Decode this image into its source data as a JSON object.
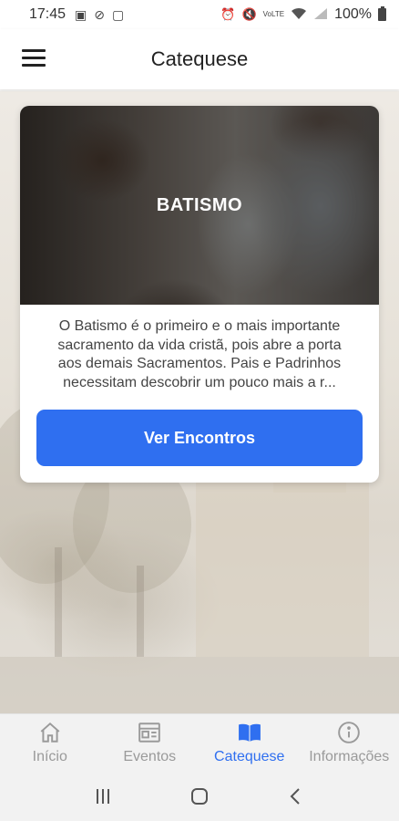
{
  "status_bar": {
    "time": "17:45",
    "battery": "100%",
    "left_icons": [
      "image-icon",
      "block-icon",
      "app-icon"
    ],
    "right_icons": [
      "alarm-icon",
      "mute-icon",
      "volte-icon",
      "wifi-icon",
      "signal-icon"
    ]
  },
  "header": {
    "title": "Catequese",
    "menu_icon": "hamburger-menu-icon"
  },
  "card": {
    "title": "BATISMO",
    "description": "O Batismo é o primeiro e o mais importante sacramento da vida cristã, pois abre a porta aos demais Sacramentos. Pais e Padrinhos necessitam descobrir um pouco mais a r...",
    "button_label": "Ver Encontros"
  },
  "bottom_nav": {
    "items": [
      {
        "label": "Início",
        "icon": "home-icon",
        "active": false
      },
      {
        "label": "Eventos",
        "icon": "newspaper-icon",
        "active": false
      },
      {
        "label": "Catequese",
        "icon": "book-icon",
        "active": true
      },
      {
        "label": "Informações",
        "icon": "info-icon",
        "active": false
      }
    ]
  },
  "system_nav": {
    "buttons": [
      "recent-apps-icon",
      "home-button-icon",
      "back-icon"
    ]
  },
  "colors": {
    "accent": "#2f6ff0",
    "inactive": "#9a9a9a"
  }
}
